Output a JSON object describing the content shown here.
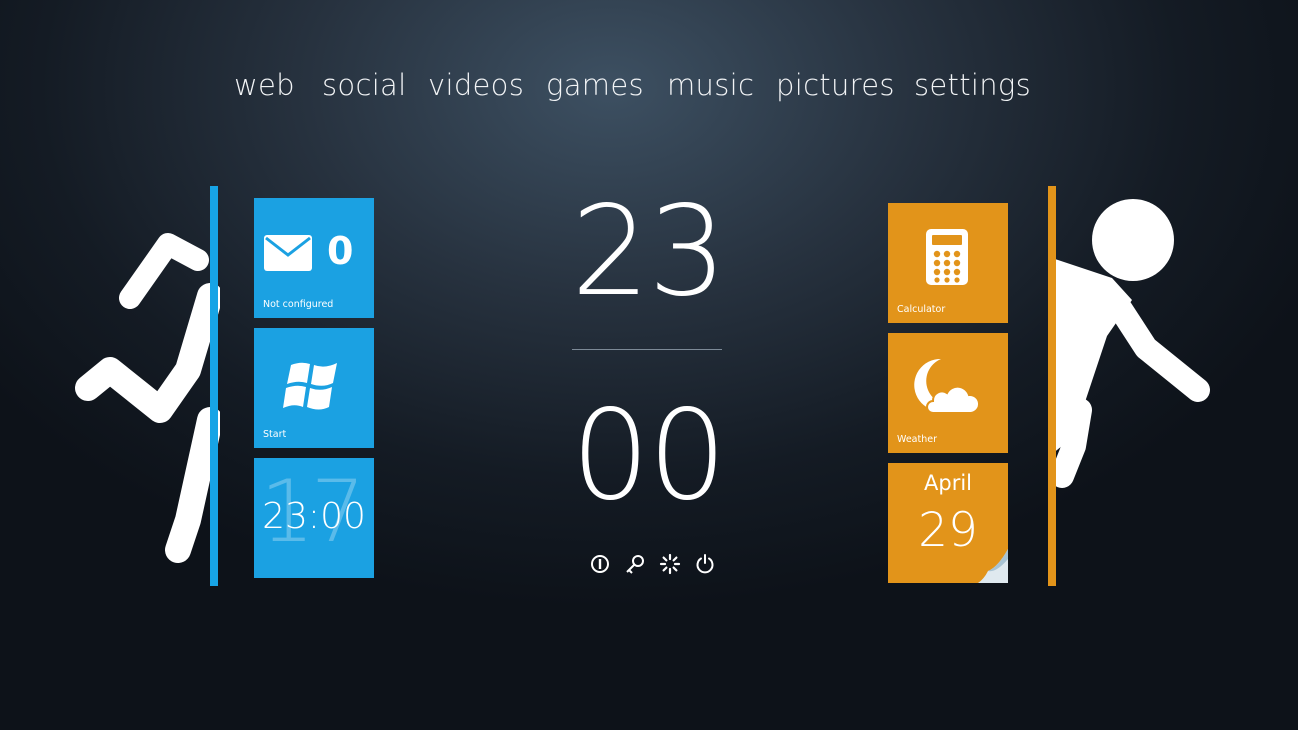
{
  "nav": {
    "items": [
      {
        "label": "web"
      },
      {
        "label": "social"
      },
      {
        "label": "videos"
      },
      {
        "label": "games"
      },
      {
        "label": "music"
      },
      {
        "label": "pictures"
      },
      {
        "label": "settings"
      }
    ]
  },
  "tiles": {
    "mail": {
      "count": "0",
      "label": "Not configured",
      "icon": "mail-icon"
    },
    "start": {
      "label": "Start",
      "icon": "windows-logo-icon"
    },
    "clock": {
      "background_number": "17",
      "time": "23:00"
    },
    "calculator": {
      "label": "Calculator",
      "icon": "calculator-icon"
    },
    "weather": {
      "label": "Weather",
      "icon": "moon-cloud-icon"
    },
    "calendar": {
      "month": "April",
      "day": "29"
    }
  },
  "clock": {
    "hour": "23",
    "minute": "00"
  },
  "system_buttons": [
    {
      "icon": "info-circle-icon"
    },
    {
      "icon": "key-icon"
    },
    {
      "icon": "spinner-icon"
    },
    {
      "icon": "power-icon"
    }
  ],
  "colors": {
    "blue_accent": "#1ba1e2",
    "orange_accent": "#e2941a",
    "background_dark": "#141b24"
  }
}
